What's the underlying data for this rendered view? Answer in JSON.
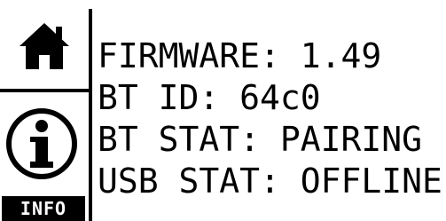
{
  "sidebar": {
    "home_icon": "home-icon",
    "info_icon": "info-circle-icon",
    "info_label": "INFO"
  },
  "status": {
    "firmware": "FIRMWARE: 1.49",
    "bt_id": "BT ID: 64c0",
    "bt_stat": "BT STAT: PAIRING",
    "usb_stat": "USB STAT: OFFLINE"
  },
  "colors": {
    "foreground": "#000000",
    "background": "#ffffff"
  }
}
